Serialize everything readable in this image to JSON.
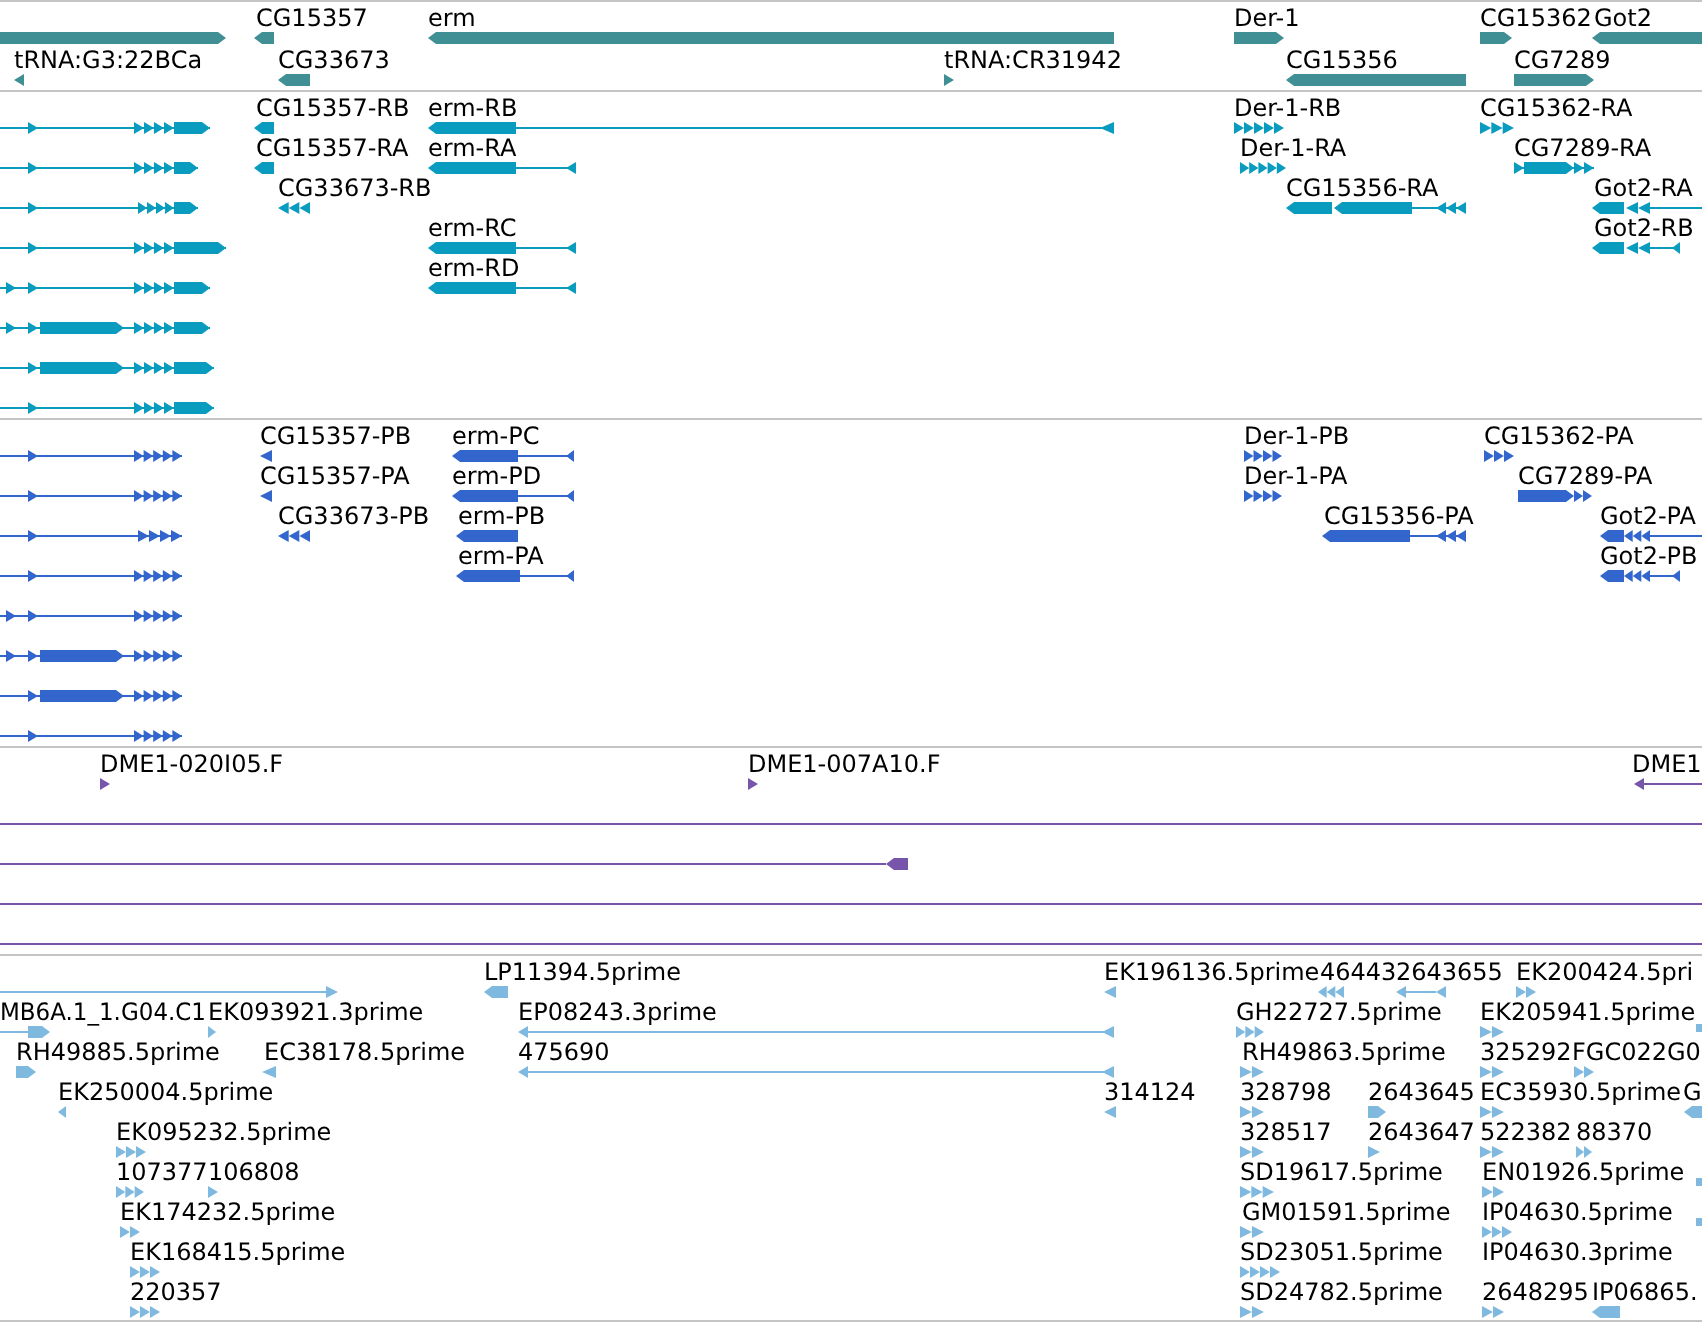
{
  "tracks": [
    {
      "kind": "gene",
      "labels": [
        "CG15357",
        "erm",
        "Der-1",
        "CG15362",
        "Got2",
        "tRNA:G3:22BCa",
        "CG33673",
        "tRNA:CR31942",
        "CG15356",
        "CG7289"
      ]
    },
    {
      "kind": "transcript",
      "labels": [
        "CG15357-RB",
        "erm-RB",
        "Der-1-RB",
        "CG15362-RA",
        "CG15357-RA",
        "erm-RA",
        "Der-1-RA",
        "CG7289-RA",
        "CG33673-RB",
        "CG15356-RA",
        "Got2-RA",
        "erm-RC",
        "Got2-RB",
        "erm-RD"
      ]
    },
    {
      "kind": "protein",
      "labels": [
        "CG15357-PB",
        "erm-PC",
        "Der-1-PB",
        "CG15362-PA",
        "CG15357-PA",
        "erm-PD",
        "Der-1-PA",
        "CG7289-PA",
        "CG33673-PB",
        "erm-PB",
        "CG15356-PA",
        "Got2-PA",
        "erm-PA",
        "Got2-PB"
      ]
    },
    {
      "kind": "read",
      "labels": [
        "DME1-020I05.F",
        "DME1-007A10.F",
        "DME1"
      ]
    },
    {
      "kind": "est",
      "labels": [
        "LP11394.5prime",
        "EK196136.5prime",
        "46443",
        "2643655",
        "EK200424.5pri",
        "MB6A.1_1.G04.C1",
        "EK093921.3prime",
        "EP08243.3prime",
        "GH22727.5prime",
        "EK205941.5prime",
        "RH49885.5prime",
        "EC38178.5prime",
        "475690",
        "RH49863.5prime",
        "325292",
        "FGC022G0",
        "EK250004.5prime",
        "314124",
        "328798",
        "2643645",
        "EC35930.5prime",
        "G",
        "EK095232.5prime",
        "328517",
        "2643647",
        "522382",
        "88370",
        "107377",
        "106808",
        "SD19617.5prime",
        "EN01926.5prime",
        "EK174232.5prime",
        "GM01591.5prime",
        "IP04630.5prime",
        "EK168415.5prime",
        "SD23051.5prime",
        "IP04630.3prime",
        "220357",
        "SD24782.5prime",
        "2648295",
        "IP06865."
      ]
    }
  ]
}
